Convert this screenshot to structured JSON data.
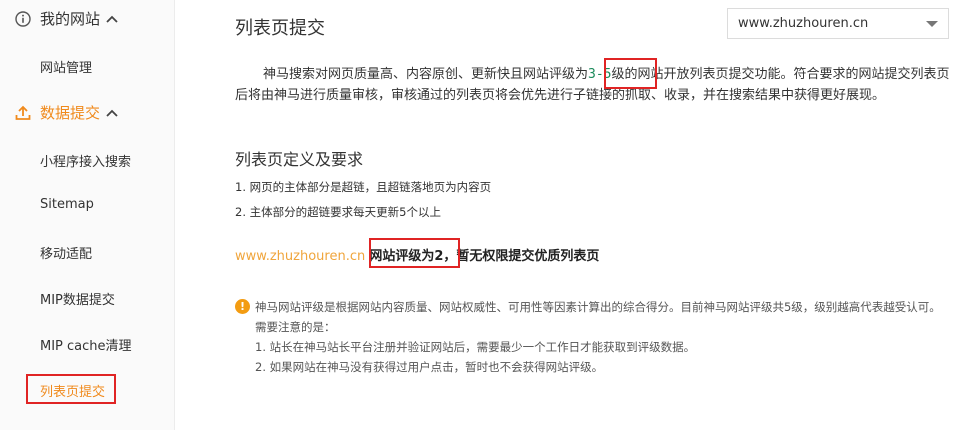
{
  "sidebar": {
    "groups": [
      {
        "label": "我的网站",
        "icon": "info-circle-icon",
        "items": [
          {
            "label": "网站管理"
          }
        ]
      },
      {
        "label": "数据提交",
        "icon": "upload-icon",
        "items": [
          {
            "label": "小程序接入搜索"
          },
          {
            "label": "Sitemap"
          },
          {
            "label": "移动适配"
          },
          {
            "label": "MIP数据提交"
          },
          {
            "label": "MIP cache清理"
          },
          {
            "label": "列表页提交"
          }
        ]
      }
    ]
  },
  "main": {
    "title": "列表页提交",
    "site_select": {
      "value": "www.zhuzhouren.cn"
    },
    "intro": {
      "before": "神马搜索对网页质量高、内容原创、更新快且网站评级为",
      "highlight": "3-5",
      "after": "级的网站开放列表页提交功能。符合要求的网站提交列表页后将由神马进行质量审核，审核通过的列表页将会优先进行子链接的抓取、收录，并在搜索结果中获得更好展现。"
    },
    "section_title": "列表页定义及要求",
    "requirements": [
      "1. 网页的主体部分是超链，且超链落地页为内容页",
      "2. 主体部分的超链要求每天更新5个以上"
    ],
    "status": {
      "domain": "www.zhuzhouren.cn",
      "rating": "网站评级为2",
      "message": "，暂无权限提交优质列表页"
    },
    "note": {
      "lines": [
        "神马网站评级是根据网站内容质量、网站权威性、可用性等因素计算出的综合得分。目前神马网站评级共5级，级别越高代表越受认可。需要注意的是：",
        "1. 站长在神马站长平台注册并验证网站后，需要最少一个工作日才能获取到评级数据。",
        "2. 如果网站在神马没有获得过用户点击，暂时也不会获得网站评级。"
      ]
    }
  },
  "colors": {
    "accent": "#f08a1c",
    "highlight": "#e02424",
    "rating_green": "#1b8a5a"
  }
}
